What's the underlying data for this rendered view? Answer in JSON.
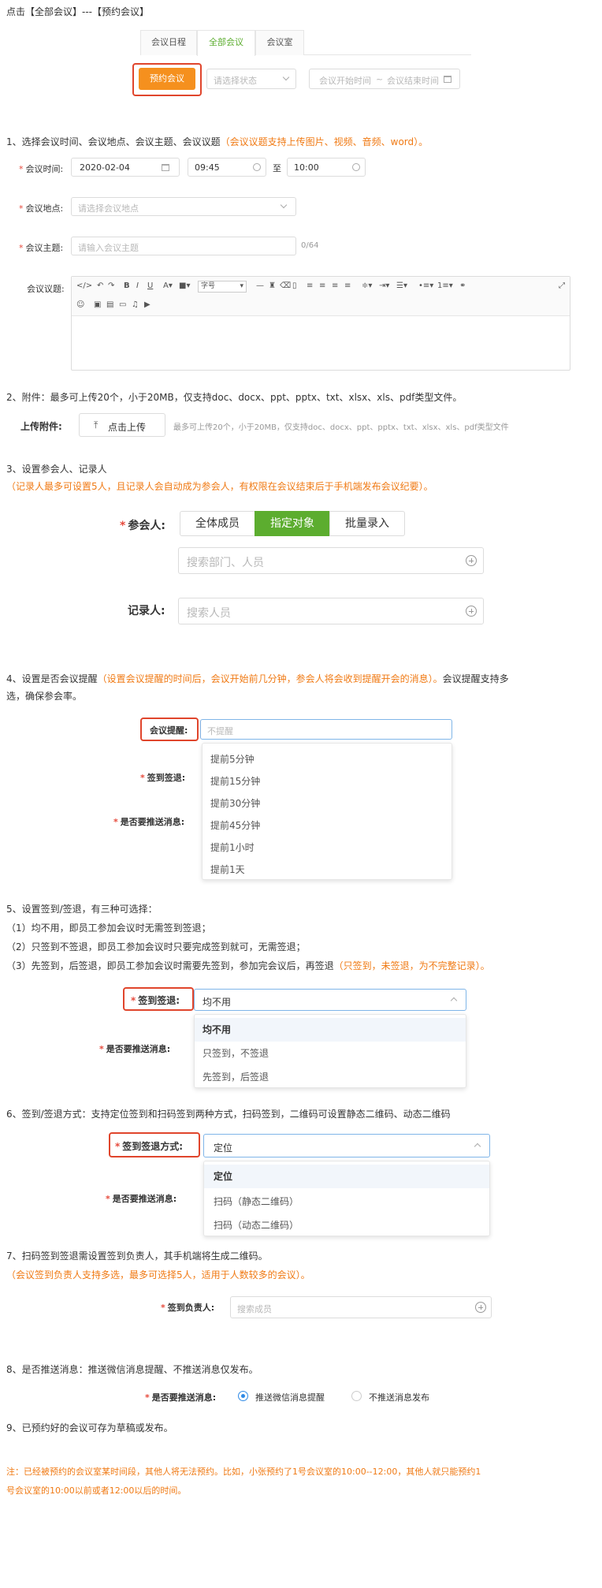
{
  "header": {
    "breadcrumb": "点击【全部会议】---【预约会议】"
  },
  "tabs": [
    {
      "label": "会议日程"
    },
    {
      "label": "全部会议"
    },
    {
      "label": "会议室"
    }
  ],
  "toolbar": {
    "book_label": "预约会议",
    "status_placeholder": "请选择状态",
    "start_placeholder": "会议开始时间",
    "range_sep": "~",
    "end_placeholder": "会议结束时间"
  },
  "step1": {
    "text": "1、选择会议时间、会议地点、会议主题、会议议题",
    "note": "（会议议题支持上传图片、视频、音频、word）。",
    "time_label": "会议时间:",
    "date_value": "2020-02-04",
    "start_time": "09:45",
    "to": "至",
    "end_time": "10:00",
    "place_label": "会议地点:",
    "place_placeholder": "请选择会议地点",
    "subject_label": "会议主题:",
    "subject_placeholder": "请输入会议主题",
    "subject_count": "0/64",
    "topic_label": "会议议题:",
    "font_size_select": "字号"
  },
  "step2": {
    "text": "2、附件：最多可上传20个，小于20MB，仅支持doc、docx、ppt、pptx、txt、xlsx、xls、pdf类型文件。",
    "upload_label": "上传附件:",
    "upload_button": "点击上传",
    "upload_hint": "最多可上传20个，小于20MB，仅支持doc、docx、ppt、pptx、txt、xlsx、xls、pdf类型文件"
  },
  "step3": {
    "text": "3、设置参会人、记录人",
    "note": "（记录人最多可设置5人，且记录人会自动成为参会人，有权限在会议结束后于手机端发布会议纪要）。",
    "attendee_label": "参会人:",
    "seg_all": "全体成员",
    "seg_specified": "指定对象",
    "seg_batch": "批量录入",
    "search_placeholder": "搜索部门、人员",
    "recorder_label": "记录人:",
    "recorder_placeholder": "搜索人员"
  },
  "step4": {
    "text_a": "4、设置是否会议提醒",
    "note": "（设置会议提醒的时间后，会议开始前几分钟，参会人将会收到提醒开会的消息）。",
    "text_b": "会议提醒支持多",
    "text_c": "选，确保参会率。",
    "reminder_label": "会议提醒:",
    "reminder_placeholder": "不提醒",
    "sign_label": "签到签退:",
    "push_label": "是否要推送消息:",
    "options": [
      "提前5分钟",
      "提前15分钟",
      "提前30分钟",
      "提前45分钟",
      "提前1小时",
      "提前1天"
    ]
  },
  "step5": {
    "text": "5、设置签到/签退，有三种可选择：",
    "line1": "（1）均不用，即员工参加会议时无需签到签退；",
    "line2": "（2）只签到不签退，即员工参加会议时只要完成签到就可，无需签退；",
    "line3": "（3）先签到，后签退，即员工参加会议时需要先签到，参加完会议后，再签退",
    "line3_note": "（只签到，未签退，为不完整记录）。",
    "sign_label": "签到签退:",
    "sign_value": "均不用",
    "push_label": "是否要推送消息:",
    "options": [
      "均不用",
      "只签到，不签退",
      "先签到，后签退"
    ]
  },
  "step6": {
    "text": "6、签到/签退方式：支持定位签到和扫码签到两种方式，扫码签到，二维码可设置静态二维码、动态二维码",
    "method_label": "签到签退方式:",
    "method_value": "定位",
    "push_label": "是否要推送消息:",
    "options": [
      "定位",
      "扫码（静态二维码）",
      "扫码（动态二维码）"
    ]
  },
  "step7": {
    "text": "7、扫码签到签退需设置签到负责人，其手机端将生成二维码。",
    "note": "（会议签到负责人支持多选，最多可选择5人，适用于人数较多的会议）。",
    "owner_label": "签到负责人:",
    "owner_placeholder": "搜索成员"
  },
  "step8": {
    "text": "8、是否推送消息：推送微信消息提醒、不推送消息仅发布。",
    "push_label": "是否要推送消息:",
    "opt_push": "推送微信消息提醒",
    "opt_no_push": "不推送消息发布"
  },
  "step9": {
    "text": "9、已预约好的会议可存为草稿或发布。"
  },
  "footnote": {
    "line1": "注：已经被预约的会议室某时间段，其他人将无法预约。比如，小张预约了1号会议室的10:00--12:00，其他人就只能预约1",
    "line2": "号会议室的10:00以前或者12:00以后的时间。"
  }
}
